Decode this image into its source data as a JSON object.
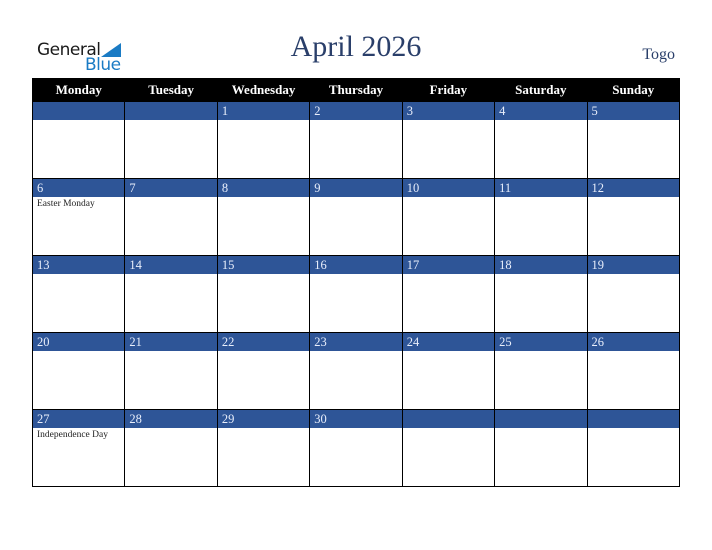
{
  "brand": {
    "line1": "General",
    "line2": "Blue",
    "icon": "triangle-flag-icon",
    "accent_color": "#1a7bc4"
  },
  "title": "April 2026",
  "country": "Togo",
  "colors": {
    "header_bg": "#000000",
    "day_bar": "#2e5597",
    "title": "#2a3f6a"
  },
  "weekdays": [
    "Monday",
    "Tuesday",
    "Wednesday",
    "Thursday",
    "Friday",
    "Saturday",
    "Sunday"
  ],
  "weeks": [
    [
      {
        "day": "",
        "holiday": ""
      },
      {
        "day": "",
        "holiday": ""
      },
      {
        "day": "1",
        "holiday": ""
      },
      {
        "day": "2",
        "holiday": ""
      },
      {
        "day": "3",
        "holiday": ""
      },
      {
        "day": "4",
        "holiday": ""
      },
      {
        "day": "5",
        "holiday": ""
      }
    ],
    [
      {
        "day": "6",
        "holiday": "Easter Monday"
      },
      {
        "day": "7",
        "holiday": ""
      },
      {
        "day": "8",
        "holiday": ""
      },
      {
        "day": "9",
        "holiday": ""
      },
      {
        "day": "10",
        "holiday": ""
      },
      {
        "day": "11",
        "holiday": ""
      },
      {
        "day": "12",
        "holiday": ""
      }
    ],
    [
      {
        "day": "13",
        "holiday": ""
      },
      {
        "day": "14",
        "holiday": ""
      },
      {
        "day": "15",
        "holiday": ""
      },
      {
        "day": "16",
        "holiday": ""
      },
      {
        "day": "17",
        "holiday": ""
      },
      {
        "day": "18",
        "holiday": ""
      },
      {
        "day": "19",
        "holiday": ""
      }
    ],
    [
      {
        "day": "20",
        "holiday": ""
      },
      {
        "day": "21",
        "holiday": ""
      },
      {
        "day": "22",
        "holiday": ""
      },
      {
        "day": "23",
        "holiday": ""
      },
      {
        "day": "24",
        "holiday": ""
      },
      {
        "day": "25",
        "holiday": ""
      },
      {
        "day": "26",
        "holiday": ""
      }
    ],
    [
      {
        "day": "27",
        "holiday": "Independence Day"
      },
      {
        "day": "28",
        "holiday": ""
      },
      {
        "day": "29",
        "holiday": ""
      },
      {
        "day": "30",
        "holiday": ""
      },
      {
        "day": "",
        "holiday": ""
      },
      {
        "day": "",
        "holiday": ""
      },
      {
        "day": "",
        "holiday": ""
      }
    ]
  ]
}
